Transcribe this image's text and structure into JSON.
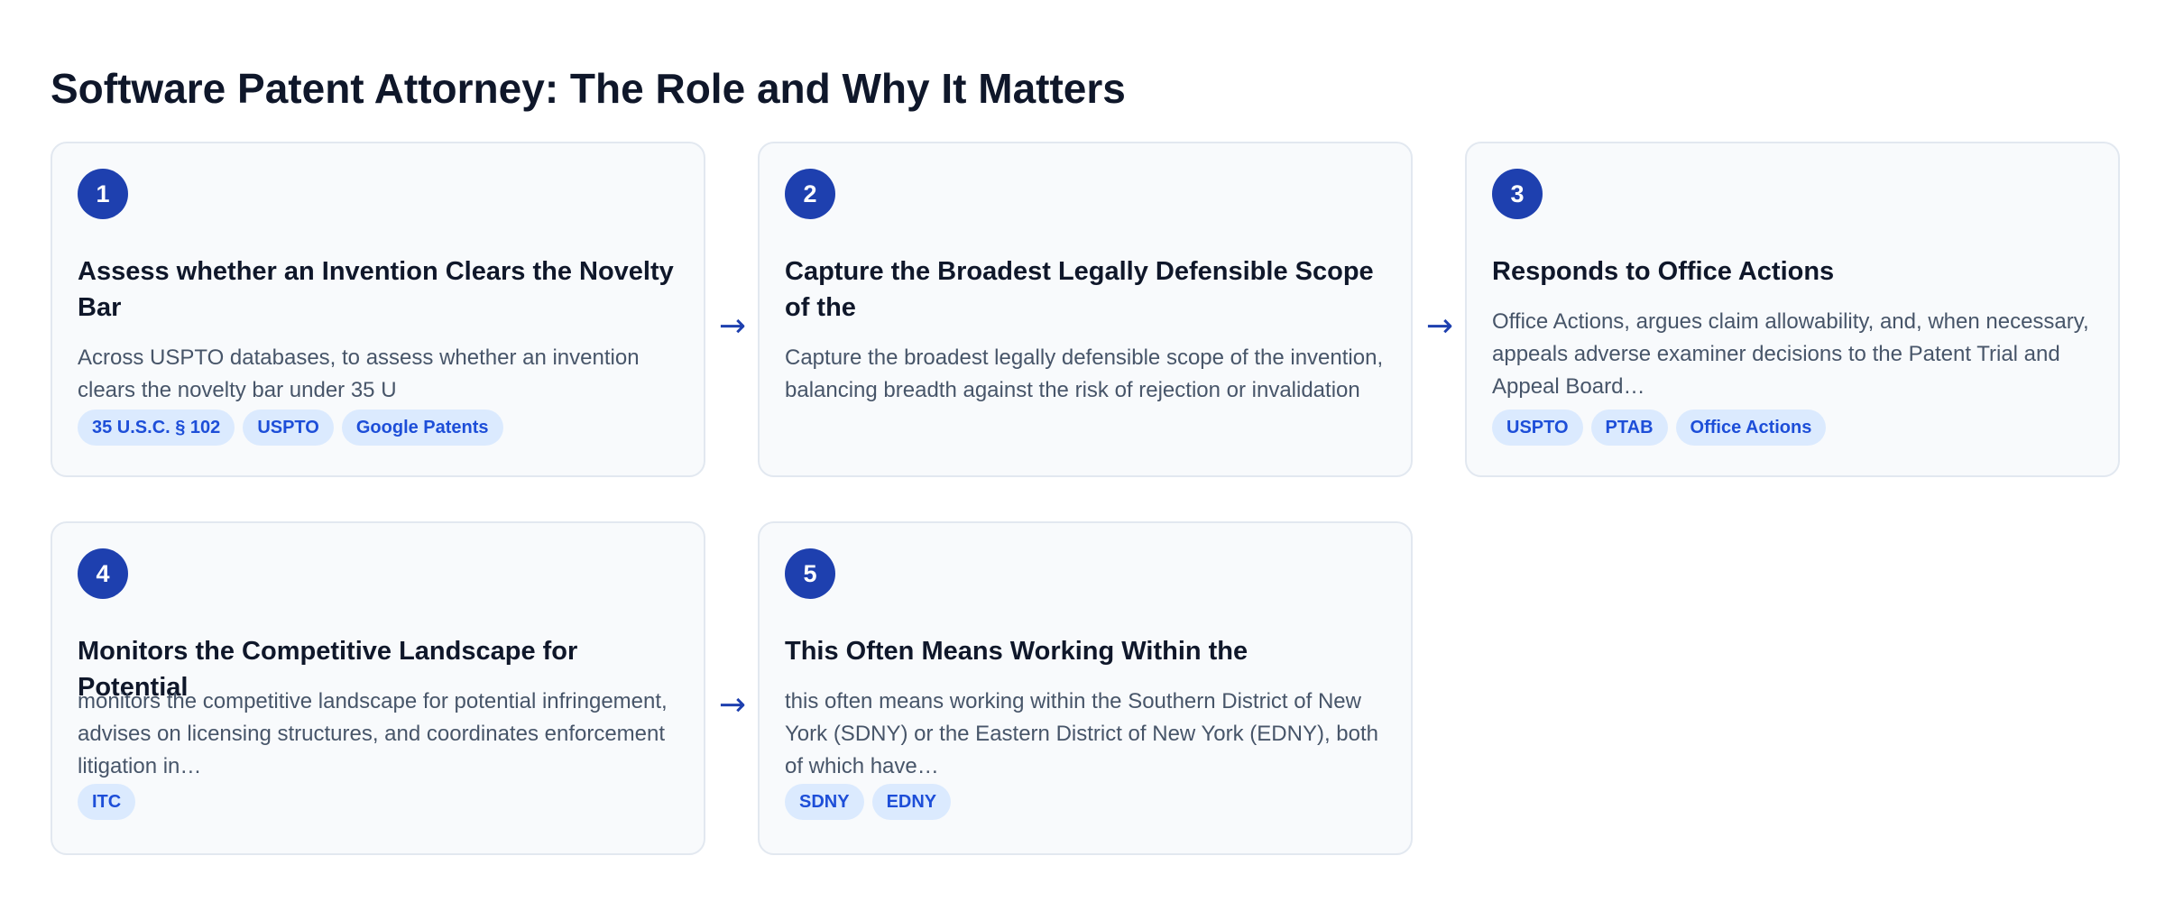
{
  "title": "Software Patent Attorney: The Role and Why It Matters",
  "steps": [
    {
      "number": "1",
      "title": "Assess whether an Invention Clears the Novelty Bar",
      "description": "Across USPTO databases, to assess whether an invention clears the novelty bar under 35 U",
      "tags": [
        "35 U.S.C. § 102",
        "USPTO",
        "Google Patents"
      ]
    },
    {
      "number": "2",
      "title": "Capture the Broadest Legally Defensible Scope of the",
      "description": "Capture the broadest legally defensible scope of the invention, balancing breadth against the risk of rejection or invalidation",
      "tags": []
    },
    {
      "number": "3",
      "title": "Responds to Office Actions",
      "description": "Office Actions, argues claim allowability, and, when necessary, appeals adverse examiner decisions to the Patent Trial and Appeal Board…",
      "tags": [
        "USPTO",
        "PTAB",
        "Office Actions"
      ]
    },
    {
      "number": "4",
      "title": "Monitors the Competitive Landscape for Potential",
      "description": "monitors the competitive landscape for potential infringement, advises on licensing structures, and coordinates enforcement litigation in…",
      "tags": [
        "ITC"
      ]
    },
    {
      "number": "5",
      "title": "This Often Means Working Within the",
      "description": "this often means working within the Southern District of New York (SDNY) or the Eastern District of New York (EDNY), both of which have…",
      "tags": [
        "SDNY",
        "EDNY"
      ]
    }
  ],
  "connector_glyph": "→",
  "colors": {
    "accent": "#1e40af",
    "tag_bg": "#dbeafe",
    "tag_text": "#1d4ed8",
    "card_bg": "#f8fafc",
    "card_border": "#e2e8f0"
  }
}
